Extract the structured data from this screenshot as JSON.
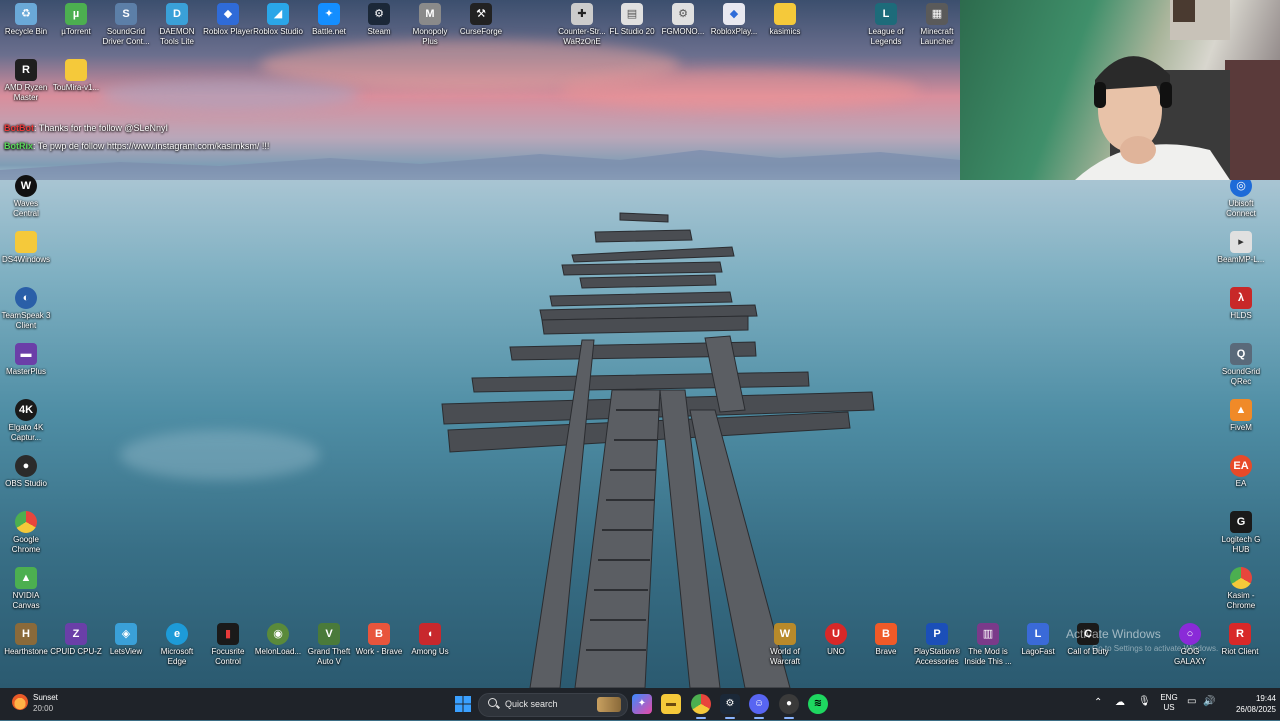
{
  "desktop_icons": {
    "top_row": [
      {
        "label": "Recycle Bin",
        "icon": "recycle-bin-icon",
        "color": "#6aa9d8"
      },
      {
        "label": "µTorrent",
        "icon": "utorrent-icon",
        "color": "#4caf50"
      },
      {
        "label": "SoundGrid Driver Cont...",
        "icon": "soundgrid-icon",
        "color": "#5c7fa8"
      },
      {
        "label": "DAEMON Tools Lite",
        "icon": "daemon-tools-icon",
        "color": "#3aa0d8"
      },
      {
        "label": "Roblox Player",
        "icon": "roblox-icon",
        "color": "#2f6bd8"
      },
      {
        "label": "Roblox Studio",
        "icon": "roblox-studio-icon",
        "color": "#2aa6e8"
      },
      {
        "label": "Battle.net",
        "icon": "battlenet-icon",
        "color": "#148eff"
      },
      {
        "label": "Steam",
        "icon": "steam-icon",
        "color": "#1b2838"
      },
      {
        "label": "Monopoly Plus",
        "icon": "monopoly-icon",
        "color": "#8a8a8a"
      },
      {
        "label": "CurseForge",
        "icon": "curseforge-icon",
        "color": "#222222"
      },
      {
        "label": "Counter-Str... WaRzOnE",
        "icon": "counter-strike-icon",
        "color": "#cccccc"
      },
      {
        "label": "FL Studio 20",
        "icon": "fl-studio-icon",
        "color": "#e0e0e0"
      },
      {
        "label": "FGMONO...",
        "icon": "file-icon",
        "color": "#e0e0e0"
      },
      {
        "label": "RobloxPlay...",
        "icon": "roblox-file-icon",
        "color": "#e8e8f0"
      },
      {
        "label": "kasimics",
        "icon": "folder-icon",
        "color": "#f5c93a"
      },
      {
        "label": "League of Legends",
        "icon": "league-icon",
        "color": "#1d6b7a"
      },
      {
        "label": "Minecraft Launcher",
        "icon": "minecraft-icon",
        "color": "#5a5a5a"
      }
    ],
    "second_row": [
      {
        "label": "AMD Ryzen Master",
        "icon": "amd-icon",
        "color": "#1f1f1f"
      },
      {
        "label": "TouMira-v1...",
        "icon": "folder-icon",
        "color": "#f5c93a"
      }
    ],
    "left_column": [
      {
        "label": "Waves Central",
        "icon": "waves-icon",
        "color": "#111111"
      },
      {
        "label": "DS4Windows",
        "icon": "folder-icon",
        "color": "#f5c93a"
      },
      {
        "label": "TeamSpeak 3 Client",
        "icon": "teamspeak-icon",
        "color": "#2a5fa8"
      },
      {
        "label": "MasterPlus",
        "icon": "masterplus-icon",
        "color": "#6b3fa8"
      },
      {
        "label": "Elgato 4K Captur...",
        "icon": "elgato-icon",
        "color": "#1a1a1a"
      },
      {
        "label": "OBS Studio",
        "icon": "obs-icon",
        "color": "#2b2b2b"
      },
      {
        "label": "Google Chrome",
        "icon": "chrome-icon",
        "color": "#e8453c"
      },
      {
        "label": "NVIDIA Canvas",
        "icon": "nvidia-canvas-icon",
        "color": "#4caf50"
      }
    ],
    "bottom_row": [
      {
        "label": "Hearthstone",
        "icon": "hearthstone-icon",
        "color": "#8a6a3a"
      },
      {
        "label": "CPUID CPU-Z",
        "icon": "cpuz-icon",
        "color": "#6a3fa8"
      },
      {
        "label": "LetsView",
        "icon": "letsview-icon",
        "color": "#3aa0d8"
      },
      {
        "label": "Microsoft Edge",
        "icon": "edge-icon",
        "color": "#1d9bd8"
      },
      {
        "label": "Focusrite Control",
        "icon": "focusrite-icon",
        "color": "#1a1a1a"
      },
      {
        "label": "MelonLoad...",
        "icon": "melonloader-icon",
        "color": "#5a8a3a"
      },
      {
        "label": "Grand Theft Auto V",
        "icon": "gta-icon",
        "color": "#4a7a3a"
      },
      {
        "label": "Work - Brave",
        "icon": "brave-work-icon",
        "color": "#e8553c"
      },
      {
        "label": "Among Us",
        "icon": "among-us-icon",
        "color": "#c8282d"
      },
      {
        "label": "World of Warcraft",
        "icon": "wow-icon",
        "color": "#b88a2a"
      },
      {
        "label": "UNO",
        "icon": "uno-icon",
        "color": "#d82828"
      },
      {
        "label": "Brave",
        "icon": "brave-icon",
        "color": "#f05a28"
      },
      {
        "label": "PlayStation® Accessories",
        "icon": "playstation-icon",
        "color": "#1b4fb8"
      },
      {
        "label": "The Mod is Inside This ...",
        "icon": "winrar-icon",
        "color": "#7a3a8a"
      },
      {
        "label": "LagoFast",
        "icon": "lagofast-icon",
        "color": "#3a6ad8"
      },
      {
        "label": "Call of Duty",
        "icon": "cod-icon",
        "color": "#1a1a1a"
      },
      {
        "label": "GOG GALAXY",
        "icon": "gog-icon",
        "color": "#8a2ad8"
      },
      {
        "label": "Riot Client",
        "icon": "riot-icon",
        "color": "#d82828"
      }
    ],
    "right_column": [
      {
        "label": "Ubisoft Connect",
        "icon": "ubisoft-icon",
        "color": "#1d6bd8"
      },
      {
        "label": "BeamMP-L...",
        "icon": "beammp-icon",
        "color": "#e0e0e0"
      },
      {
        "label": "HLDS",
        "icon": "hlds-icon",
        "color": "#c82828"
      },
      {
        "label": "SoundGrid QRec",
        "icon": "soundgrid-qrec-icon",
        "color": "#5a6a7a"
      },
      {
        "label": "FiveM",
        "icon": "fivem-icon",
        "color": "#f08a28"
      },
      {
        "label": "EA",
        "icon": "ea-icon",
        "color": "#e84a28"
      },
      {
        "label": "Logitech G HUB",
        "icon": "logitech-icon",
        "color": "#1a1a1a"
      },
      {
        "label": "Kasim - Chrome",
        "icon": "chrome-profile-icon",
        "color": "#e8453c"
      }
    ]
  },
  "chat": [
    {
      "user": "BotBot",
      "text": ": Thanks for the follow @SLeNnyI",
      "user_color": "#e83a3a"
    },
    {
      "user": "BotRix",
      "text": ": Te pwp de follow https://www.instagram.com/kasimksm/ !!!",
      "user_color": "#5ad85a"
    }
  ],
  "watermark": {
    "title": "Activate Windows",
    "subtitle": "Go to Settings to activate Windows."
  },
  "taskbar": {
    "weather_title": "Sunset",
    "weather_time": "20:00",
    "search_placeholder": "Quick search",
    "lang_top": "ENG",
    "lang_bottom": "US",
    "time": "19:44",
    "date": "26/08/2025",
    "pinned": [
      {
        "name": "start-button",
        "color": "#3aa0ff"
      },
      {
        "name": "copilot-app",
        "color": "#3a8aff"
      },
      {
        "name": "file-explorer-app",
        "color": "#f5c93a"
      },
      {
        "name": "chrome-app",
        "color": "#e8453c"
      },
      {
        "name": "steam-app",
        "color": "#1b2838"
      },
      {
        "name": "discord-app",
        "color": "#5865f2"
      },
      {
        "name": "obs-app",
        "color": "#3a3a3a"
      },
      {
        "name": "spotify-app",
        "color": "#1ed760"
      }
    ]
  }
}
